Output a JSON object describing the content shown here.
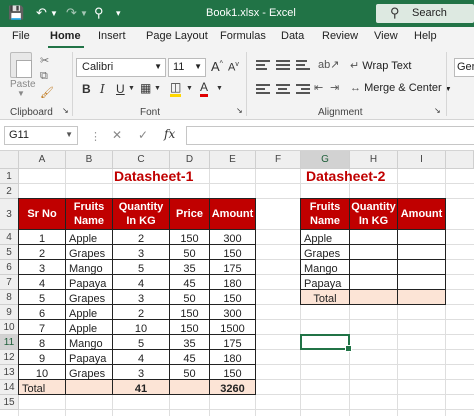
{
  "window": {
    "title": "Book1.xlsx  -  Excel",
    "search_label": "Search"
  },
  "tabs": [
    "File",
    "Home",
    "Insert",
    "Page Layout",
    "Formulas",
    "Data",
    "Review",
    "View",
    "Help"
  ],
  "ribbon": {
    "paste_label": "Paste",
    "clipboard_label": "Clipboard",
    "font_name": "Calibri",
    "font_size": "11",
    "font_label": "Font",
    "wrap_text": "Wrap Text",
    "merge_center": "Merge & Center",
    "alignment_label": "Alignment",
    "number_format": "Ger"
  },
  "formula_bar": {
    "name_box": "G11",
    "fx": "fx",
    "content": ""
  },
  "columns": [
    "A",
    "B",
    "C",
    "D",
    "E",
    "F",
    "G",
    "H",
    "I"
  ],
  "rows": [
    "1",
    "2",
    "3",
    "4",
    "5",
    "6",
    "7",
    "8",
    "9",
    "10",
    "11",
    "12",
    "13",
    "14",
    "15"
  ],
  "active_cell": "G11",
  "dataset1": {
    "title": "Datasheet-1",
    "headers": [
      "Sr No",
      "Fruits\nName",
      "Quantity\nIn KG",
      "Price",
      "Amount"
    ],
    "rows": [
      [
        "1",
        "Apple",
        "2",
        "150",
        "300"
      ],
      [
        "2",
        "Grapes",
        "3",
        "50",
        "150"
      ],
      [
        "3",
        "Mango",
        "5",
        "35",
        "175"
      ],
      [
        "4",
        "Papaya",
        "4",
        "45",
        "180"
      ],
      [
        "5",
        "Grapes",
        "3",
        "50",
        "150"
      ],
      [
        "6",
        "Apple",
        "2",
        "150",
        "300"
      ],
      [
        "7",
        "Apple",
        "10",
        "150",
        "1500"
      ],
      [
        "8",
        "Mango",
        "5",
        "35",
        "175"
      ],
      [
        "9",
        "Papaya",
        "4",
        "45",
        "180"
      ],
      [
        "10",
        "Grapes",
        "3",
        "50",
        "150"
      ]
    ],
    "total": [
      "Total",
      "",
      "41",
      "",
      "3260"
    ]
  },
  "dataset2": {
    "title": "Datasheet-2",
    "headers": [
      "Fruits\nName",
      "Quantity\nIn KG",
      "Amount"
    ],
    "rows": [
      [
        "Apple",
        "",
        ""
      ],
      [
        "Grapes",
        "",
        ""
      ],
      [
        "Mango",
        "",
        ""
      ],
      [
        "Papaya",
        "",
        ""
      ]
    ],
    "total": [
      "Total",
      "",
      ""
    ]
  },
  "colors": {
    "accent": "#217346",
    "header_fill": "#c00000",
    "total_fill": "#fce4d6"
  }
}
